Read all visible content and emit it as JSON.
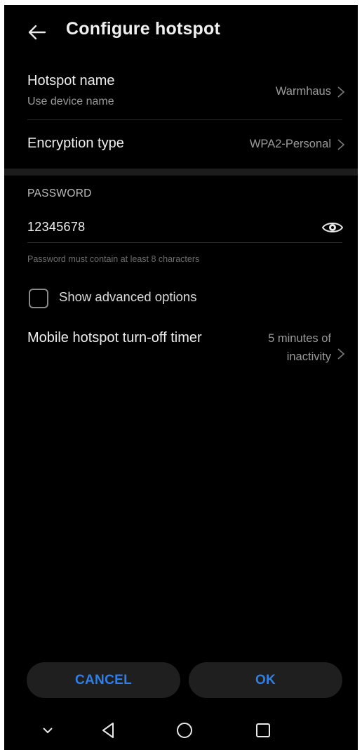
{
  "header": {
    "title": "Configure hotspot",
    "back_icon": "arrow-left-icon"
  },
  "hotspot_name": {
    "label": "Hotspot name",
    "sublabel": "Use device name",
    "value": "Warmhaus"
  },
  "encryption": {
    "label": "Encryption type",
    "value": "WPA2-Personal"
  },
  "password": {
    "header": "PASSWORD",
    "value": "12345678",
    "hint": "Password must contain at least 8 characters",
    "toggle_icon": "eye-icon"
  },
  "advanced": {
    "label": "Show advanced options",
    "checked": false
  },
  "timer": {
    "label": "Mobile hotspot turn-off timer",
    "value": "5 minutes of inactivity"
  },
  "actions": {
    "cancel": "CANCEL",
    "ok": "OK"
  },
  "navbar": {
    "icons": [
      "chevron-down-icon",
      "back-triangle-icon",
      "home-circle-icon",
      "recents-square-icon"
    ]
  },
  "colors": {
    "background": "#000000",
    "accent": "#2f7fe6",
    "button_bg": "#1f1f1f"
  }
}
